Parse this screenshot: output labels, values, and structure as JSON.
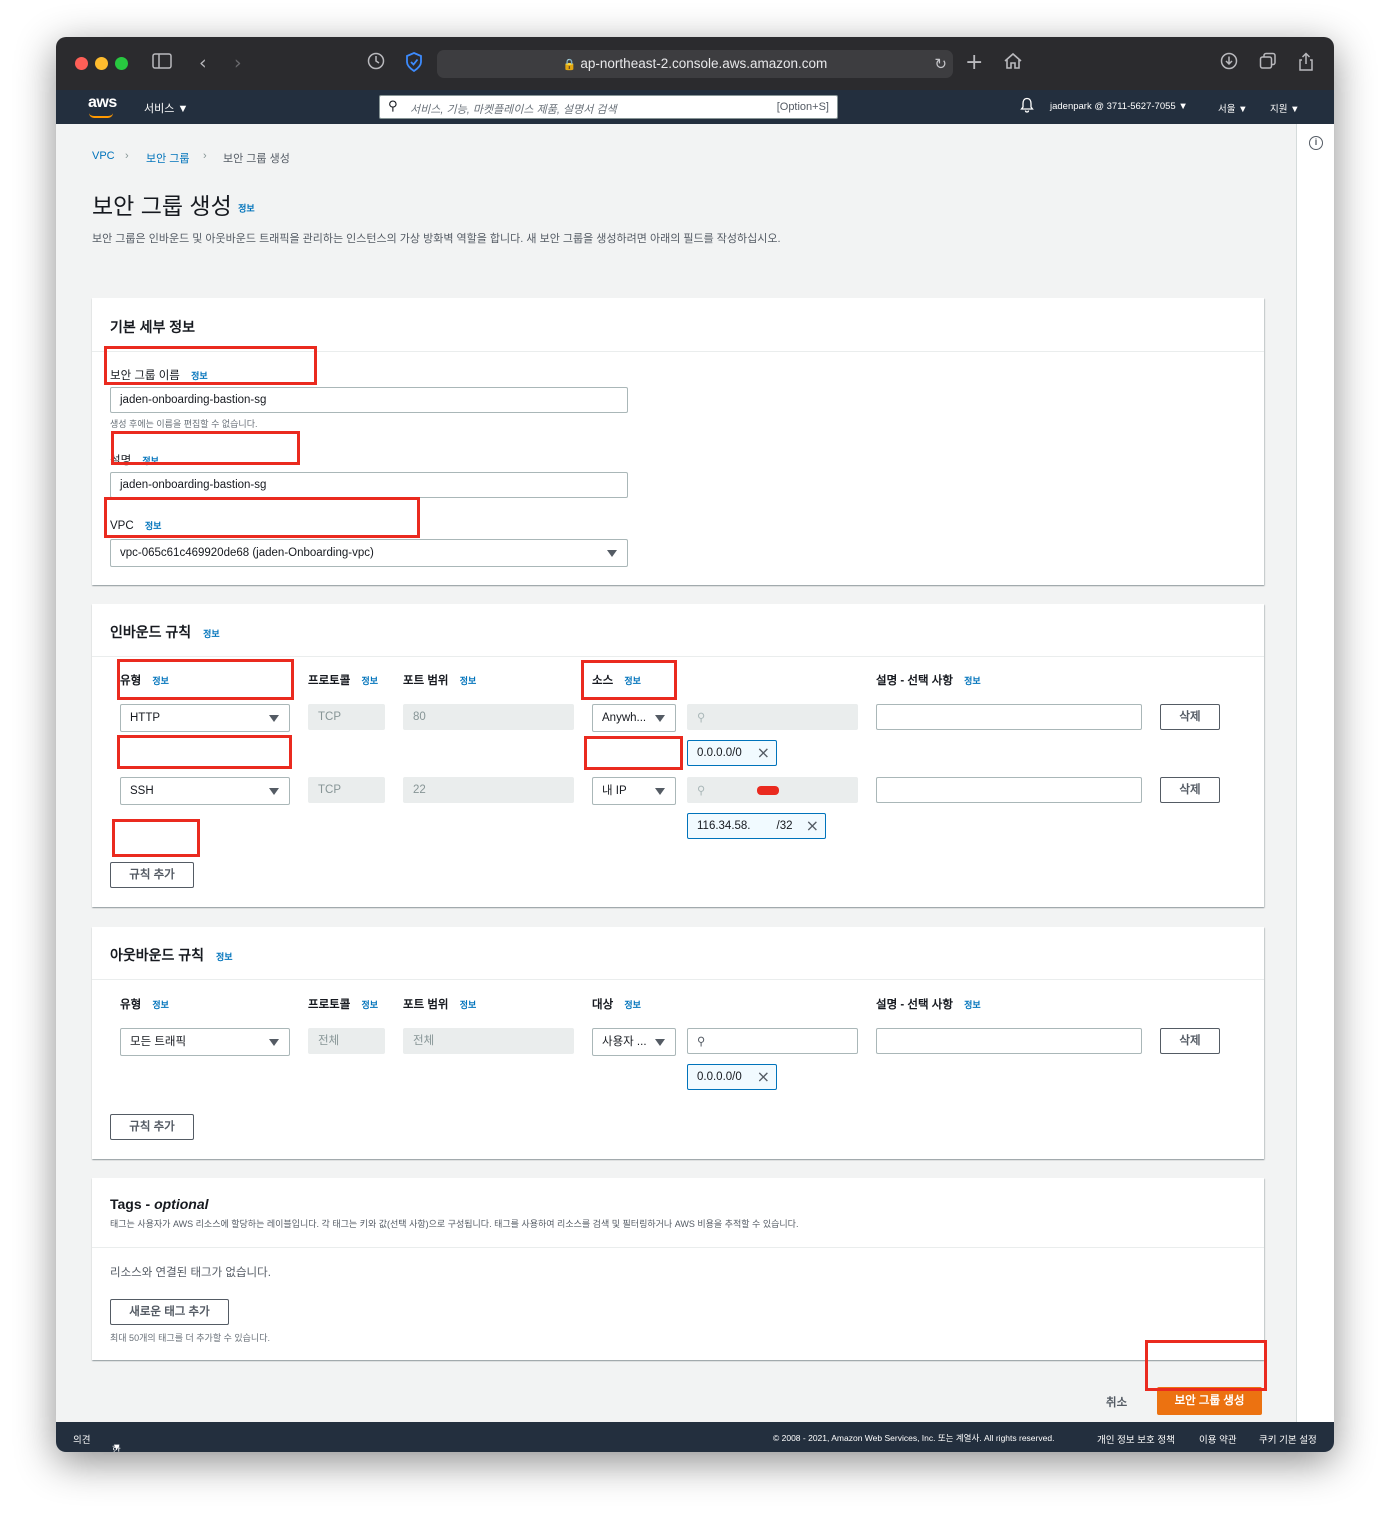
{
  "browser": {
    "url": "ap-northeast-2.console.aws.amazon.com"
  },
  "awsnav": {
    "logo": "aws",
    "services": "서비스",
    "search_placeholder": "서비스, 기능, 마켓플레이스 제품, 설명서 검색",
    "search_shortcut": "[Option+S]",
    "account": "jadenpark @ 3711-5627-7055",
    "region": "서울",
    "support": "지원"
  },
  "breadcrumb": {
    "vpc": "VPC",
    "security_groups": "보안 그룹",
    "current": "보안 그룹 생성"
  },
  "page": {
    "title": "보안 그룹 생성",
    "info": "정보",
    "description": "보안 그룹은 인바운드 및 아웃바운드 트래픽을 관리하는 인스턴스의 가상 방화벽 역할을 합니다. 새 보안 그룹을 생성하려면 아래의 필드를 작성하십시오."
  },
  "basic": {
    "title": "기본 세부 정보",
    "name_label": "보안 그룹 이름",
    "name_value": "jaden-onboarding-bastion-sg",
    "name_help": "생성 후에는 이름을 편집할 수 없습니다.",
    "desc_label": "설명",
    "desc_value": "jaden-onboarding-bastion-sg",
    "vpc_label": "VPC",
    "vpc_value": "vpc-065c61c469920de68 (jaden-Onboarding-vpc)"
  },
  "inbound": {
    "title": "인바운드 규칙",
    "col_type": "유형",
    "col_protocol": "프로토콜",
    "col_port": "포트 범위",
    "col_source": "소스",
    "col_desc": "설명 - 선택 사항",
    "rows": [
      {
        "type": "HTTP",
        "protocol": "TCP",
        "port": "80",
        "source": "Anywh...",
        "token": "0.0.0.0/0",
        "delete": "삭제"
      },
      {
        "type": "SSH",
        "protocol": "TCP",
        "port": "22",
        "source": "내 IP",
        "token": "116.34.58.",
        "token_suffix": "/32",
        "delete": "삭제"
      }
    ],
    "add_rule": "규칙 추가"
  },
  "outbound": {
    "title": "아웃바운드 규칙",
    "col_type": "유형",
    "col_protocol": "프로토콜",
    "col_port": "포트 범위",
    "col_dest": "대상",
    "col_desc": "설명 - 선택 사항",
    "row": {
      "type": "모든 트래픽",
      "protocol": "전체",
      "port": "전체",
      "dest": "사용자 ...",
      "token": "0.0.0.0/0",
      "delete": "삭제"
    },
    "add_rule": "규칙 추가"
  },
  "tags": {
    "title": "Tags - ",
    "title_em": "optional",
    "desc": "태그는 사용자가 AWS 리소스에 할당하는 레이블입니다. 각 태그는 키와 값(선택 사항)으로 구성됩니다. 태그를 사용하여 리소스를 검색 및 필터링하거나 AWS 비용을 추적할 수 있습니다.",
    "empty": "리소스와 연결된 태그가 없습니다.",
    "add": "새로운 태그 추가",
    "limit": "최대 50개의 태그를 더 추가할 수 있습니다."
  },
  "actions": {
    "cancel": "취소",
    "create": "보안 그룹 생성"
  },
  "footer": {
    "feedback": "의견",
    "language": "한국어",
    "copyright": "© 2008 - 2021, Amazon Web Services, Inc. 또는 계열사. All rights reserved.",
    "privacy": "개인 정보 보호 정책",
    "terms": "이용 약관",
    "cookies": "쿠키 기본 설정"
  },
  "colors": {
    "highlight": "#ea2a1f",
    "primary": "#ec7211",
    "link": "#0073bb",
    "nav": "#232f3e"
  }
}
